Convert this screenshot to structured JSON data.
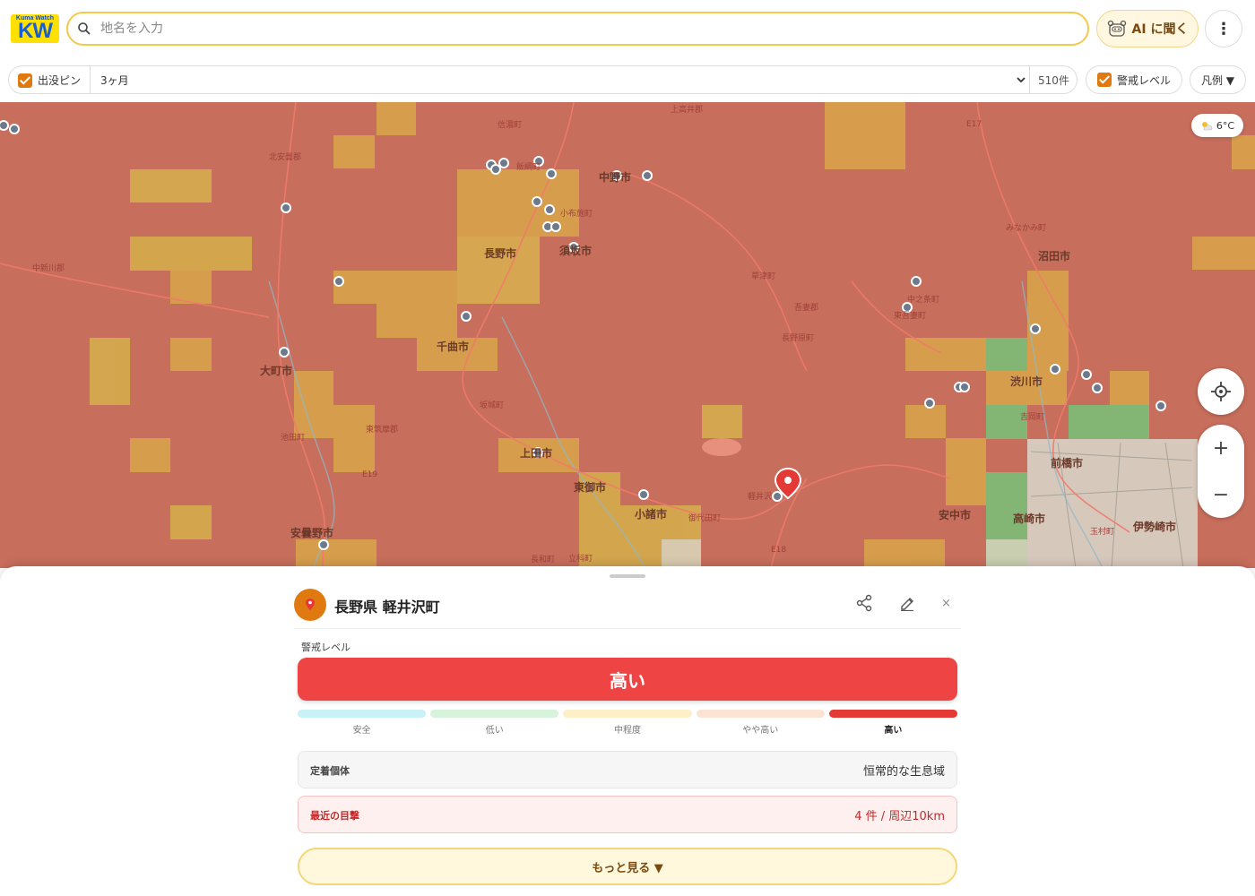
{
  "app": {
    "logo_top": "Kuma Watch",
    "logo_main": "KW"
  },
  "search": {
    "placeholder": "地名を入力",
    "value": ""
  },
  "header": {
    "ai_label": "AI に聞く",
    "more_label": "⋮"
  },
  "filters": {
    "pins_label": "出没ピン",
    "pins_checked": true,
    "period": "3ヶ月",
    "count": "510件",
    "alert_label": "警戒レベル",
    "alert_checked": true,
    "legend_label": "凡例 ▼"
  },
  "map": {
    "weather": "6°C",
    "labels": [
      {
        "text": "長野市",
        "cls": ""
      },
      {
        "text": "須坂市",
        "cls": ""
      },
      {
        "text": "中野市",
        "cls": ""
      },
      {
        "text": "千曲市",
        "cls": ""
      },
      {
        "text": "大町市",
        "cls": ""
      },
      {
        "text": "上田市",
        "cls": ""
      },
      {
        "text": "東御市",
        "cls": ""
      },
      {
        "text": "小諸市",
        "cls": ""
      },
      {
        "text": "安曇野市",
        "cls": ""
      },
      {
        "text": "沼田市",
        "cls": ""
      },
      {
        "text": "渋川市",
        "cls": ""
      },
      {
        "text": "前橋市",
        "cls": ""
      },
      {
        "text": "高崎市",
        "cls": ""
      },
      {
        "text": "安中市",
        "cls": ""
      },
      {
        "text": "伊勢崎市",
        "cls": ""
      },
      {
        "text": "信濃町",
        "cls": "small"
      },
      {
        "text": "飯綱町",
        "cls": "small"
      },
      {
        "text": "小布施町",
        "cls": "small"
      },
      {
        "text": "北安曇郡",
        "cls": "small"
      },
      {
        "text": "中新川郡",
        "cls": "small"
      },
      {
        "text": "草津町",
        "cls": "small"
      },
      {
        "text": "吾妻郡",
        "cls": "small"
      },
      {
        "text": "長野原町",
        "cls": "small"
      },
      {
        "text": "中之条町",
        "cls": "small"
      },
      {
        "text": "東吾妻町",
        "cls": "small"
      },
      {
        "text": "みなかみ町",
        "cls": "small"
      },
      {
        "text": "坂城町",
        "cls": "small"
      },
      {
        "text": "池田町",
        "cls": "small"
      },
      {
        "text": "東筑摩郡",
        "cls": "small"
      },
      {
        "text": "御代田町",
        "cls": "small"
      },
      {
        "text": "軽井沢",
        "cls": "small"
      },
      {
        "text": "長和町",
        "cls": "small"
      },
      {
        "text": "立科町",
        "cls": "small"
      },
      {
        "text": "吉岡町",
        "cls": "small"
      },
      {
        "text": "玉村町",
        "cls": "small"
      },
      {
        "text": "上高井郡",
        "cls": "small"
      },
      {
        "text": "E17",
        "cls": "small"
      },
      {
        "text": "E19",
        "cls": "small"
      },
      {
        "text": "E18",
        "cls": "small"
      }
    ],
    "zoom_in": "+",
    "zoom_out": "−"
  },
  "detail": {
    "title": "長野県 軽井沢町",
    "alert_label": "警戒レベル",
    "level": "高い",
    "scale": [
      {
        "label": "安全",
        "color": "#c9f1f6",
        "active": false
      },
      {
        "label": "低い",
        "color": "#d8f3dc",
        "active": false
      },
      {
        "label": "中程度",
        "color": "#fdf0c6",
        "active": false
      },
      {
        "label": "やや高い",
        "color": "#fde4d2",
        "active": false
      },
      {
        "label": "高い",
        "color": "#e53935",
        "active": true
      }
    ],
    "resident_key": "定着個体",
    "resident_value": "恒常的な生息域",
    "recent_key": "最近の目撃",
    "recent_value": "4 件 / 周辺10km",
    "more_label": "もっと見る ▼",
    "close_label": "×"
  }
}
